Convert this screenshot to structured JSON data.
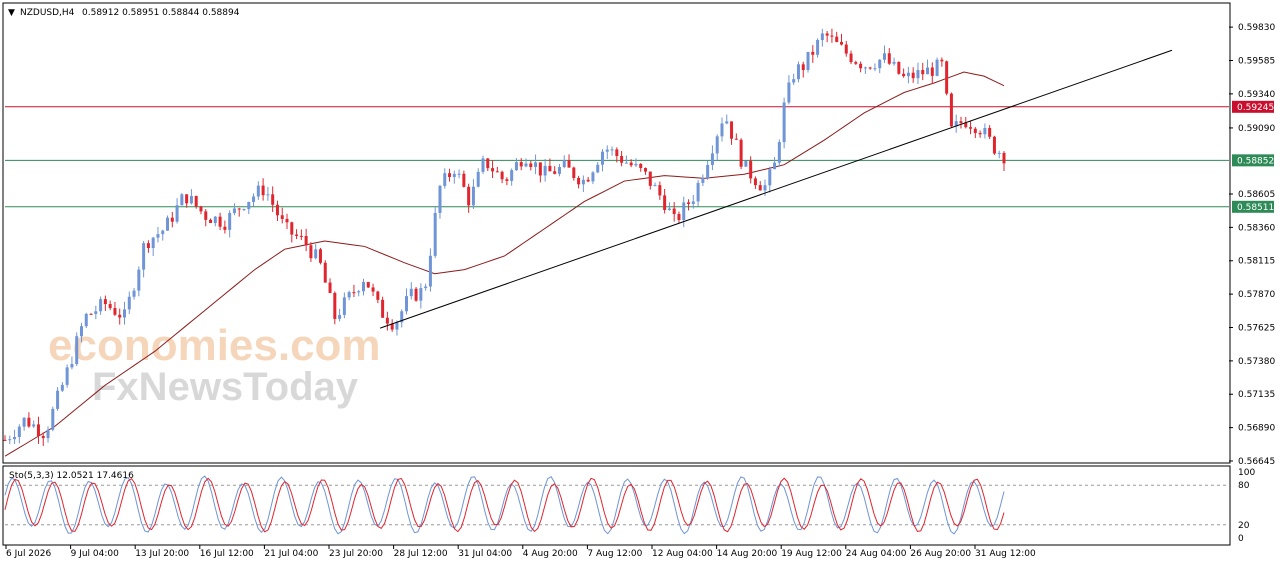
{
  "header": {
    "symbol": "NZDUSD,H4",
    "ohlc": "0.58912 0.58951 0.58844 0.58894"
  },
  "stoch_label": "Sto(5,3,3) 12.0521 17.4616",
  "watermark": {
    "line1": "economies.com",
    "line2": "FxNewsToday"
  },
  "colors": {
    "bull": "#6f95d6",
    "bear": "#e0252e",
    "ma": "#8b1a1a",
    "trendline": "#000000",
    "resistance": "#c8102e",
    "support": "#2e8b57"
  },
  "chart_data": {
    "type": "candlestick",
    "price_axis": {
      "range": [
        0.56645,
        0.59985
      ],
      "ticks": [
        "0.59830",
        "0.59585",
        "0.59340",
        "0.59090",
        "0.58605",
        "0.58360",
        "0.58115",
        "0.57870",
        "0.57625",
        "0.57380",
        "0.57135",
        "0.56890",
        "0.56645"
      ]
    },
    "time_axis": {
      "ticks": [
        "6 Jul 2026",
        "9 Jul 04:00",
        "13 Jul 20:00",
        "16 Jul 12:00",
        "21 Jul 04:00",
        "23 Jul 20:00",
        "28 Jul 12:00",
        "31 Jul 04:00",
        "4 Aug 20:00",
        "7 Aug 12:00",
        "12 Aug 04:00",
        "14 Aug 20:00",
        "19 Aug 12:00",
        "24 Aug 04:00",
        "26 Aug 20:00",
        "31 Aug 12:00"
      ]
    },
    "levels": [
      {
        "price": 0.59245,
        "label": "0.59245",
        "role": "resistance"
      },
      {
        "price": 0.58852,
        "label": "0.58852",
        "role": "support"
      },
      {
        "price": 0.58511,
        "label": "0.58511",
        "role": "support"
      }
    ],
    "trendline": {
      "from": [
        0.0,
        0.5762
      ],
      "to": [
        1.0,
        0.5966
      ]
    },
    "close_path": [
      [
        0.0,
        0.568
      ],
      [
        0.02,
        0.5695
      ],
      [
        0.04,
        0.5685
      ],
      [
        0.06,
        0.5725
      ],
      [
        0.08,
        0.577
      ],
      [
        0.1,
        0.578
      ],
      [
        0.12,
        0.577
      ],
      [
        0.14,
        0.5825
      ],
      [
        0.16,
        0.5835
      ],
      [
        0.18,
        0.586
      ],
      [
        0.2,
        0.5845
      ],
      [
        0.22,
        0.584
      ],
      [
        0.24,
        0.5855
      ],
      [
        0.26,
        0.5865
      ],
      [
        0.28,
        0.5835
      ],
      [
        0.3,
        0.5825
      ],
      [
        0.315,
        0.581
      ],
      [
        0.33,
        0.577
      ],
      [
        0.345,
        0.5785
      ],
      [
        0.36,
        0.58
      ],
      [
        0.375,
        0.5775
      ],
      [
        0.39,
        0.5765
      ],
      [
        0.405,
        0.5785
      ],
      [
        0.42,
        0.579
      ],
      [
        0.435,
        0.5865
      ],
      [
        0.45,
        0.588
      ],
      [
        0.465,
        0.5855
      ],
      [
        0.48,
        0.5885
      ],
      [
        0.5,
        0.587
      ],
      [
        0.52,
        0.589
      ],
      [
        0.54,
        0.5875
      ],
      [
        0.56,
        0.588
      ],
      [
        0.58,
        0.587
      ],
      [
        0.6,
        0.5895
      ],
      [
        0.62,
        0.5885
      ],
      [
        0.64,
        0.5875
      ],
      [
        0.66,
        0.5855
      ],
      [
        0.67,
        0.584
      ],
      [
        0.69,
        0.586
      ],
      [
        0.7,
        0.588
      ],
      [
        0.72,
        0.592
      ],
      [
        0.74,
        0.588
      ],
      [
        0.76,
        0.5865
      ],
      [
        0.77,
        0.588
      ],
      [
        0.78,
        0.5925
      ],
      [
        0.79,
        0.595
      ],
      [
        0.8,
        0.5955
      ],
      [
        0.82,
        0.5978
      ],
      [
        0.84,
        0.5965
      ],
      [
        0.86,
        0.5955
      ],
      [
        0.88,
        0.596
      ],
      [
        0.9,
        0.5945
      ],
      [
        0.92,
        0.595
      ],
      [
        0.94,
        0.5955
      ],
      [
        0.945,
        0.5905
      ],
      [
        0.96,
        0.5915
      ],
      [
        0.975,
        0.591
      ],
      [
        0.99,
        0.5895
      ],
      [
        1.0,
        0.5889
      ]
    ],
    "ma_path": [
      [
        0.0,
        0.5668
      ],
      [
        0.05,
        0.569
      ],
      [
        0.1,
        0.572
      ],
      [
        0.15,
        0.5745
      ],
      [
        0.2,
        0.5775
      ],
      [
        0.25,
        0.5805
      ],
      [
        0.28,
        0.582
      ],
      [
        0.32,
        0.5826
      ],
      [
        0.36,
        0.5822
      ],
      [
        0.4,
        0.581
      ],
      [
        0.43,
        0.5802
      ],
      [
        0.46,
        0.5805
      ],
      [
        0.5,
        0.5815
      ],
      [
        0.54,
        0.5835
      ],
      [
        0.58,
        0.5855
      ],
      [
        0.62,
        0.587
      ],
      [
        0.66,
        0.5874
      ],
      [
        0.7,
        0.5872
      ],
      [
        0.74,
        0.5875
      ],
      [
        0.78,
        0.5882
      ],
      [
        0.82,
        0.59
      ],
      [
        0.86,
        0.592
      ],
      [
        0.9,
        0.5935
      ],
      [
        0.93,
        0.5942
      ],
      [
        0.96,
        0.595
      ],
      [
        0.98,
        0.5947
      ],
      [
        1.0,
        0.594
      ]
    ],
    "stochastic": {
      "name": "Sto(5,3,3)",
      "main": 12.0521,
      "signal": 17.4616,
      "range": [
        0,
        100
      ],
      "levels": [
        20,
        80
      ],
      "ticks": [
        "100",
        "80",
        "20",
        "0"
      ]
    }
  }
}
